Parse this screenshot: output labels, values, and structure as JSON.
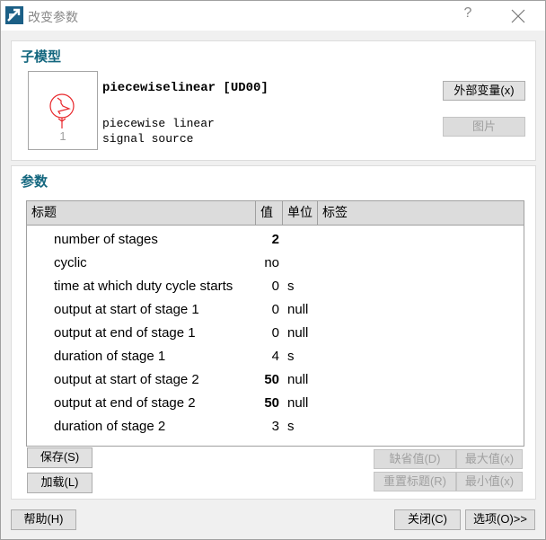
{
  "window": {
    "title": "改变参数",
    "help_label": "?",
    "close_label": "close"
  },
  "submodel": {
    "section_title": "子模型",
    "name": "piecewiselinear [UD00]",
    "description_line1": "piecewise linear",
    "description_line2": "signal source",
    "thumbnail_label": "1",
    "icon_color": "#e8262a",
    "external_vars_label": "外部变量(x)",
    "picture_label": "图片"
  },
  "params": {
    "section_title": "参数",
    "columns": [
      "标题",
      "值",
      "单位",
      "标签"
    ],
    "rows": [
      {
        "title": "number of stages",
        "value": "2",
        "unit": "",
        "bold": true
      },
      {
        "title": "cyclic",
        "value": "no",
        "unit": "",
        "bold": false
      },
      {
        "title": "time at which duty cycle starts",
        "value": "0",
        "unit": "s",
        "bold": false
      },
      {
        "title": "output at start of stage 1",
        "value": "0",
        "unit": "null",
        "bold": false
      },
      {
        "title": "output at end of stage 1",
        "value": "0",
        "unit": "null",
        "bold": false
      },
      {
        "title": "duration of stage 1",
        "value": "4",
        "unit": "s",
        "bold": false
      },
      {
        "title": "output at start of stage 2",
        "value": "50",
        "unit": "null",
        "bold": true
      },
      {
        "title": "output at end of stage 2",
        "value": "50",
        "unit": "null",
        "bold": true
      },
      {
        "title": "duration of stage 2",
        "value": "3",
        "unit": "s",
        "bold": false
      }
    ],
    "save_label": "保存(S)",
    "load_label": "加载(L)",
    "default_label": "缺省值(D)",
    "max_label": "最大值(x)",
    "reset_title_label": "重置标题(R)",
    "min_label": "最小值(x)"
  },
  "footer": {
    "help_label": "帮助(H)",
    "close_label": "关闭(C)",
    "options_label": "选项(O)>>"
  },
  "colors": {
    "accent": "#14677f",
    "app_icon": "#1b5f86"
  }
}
